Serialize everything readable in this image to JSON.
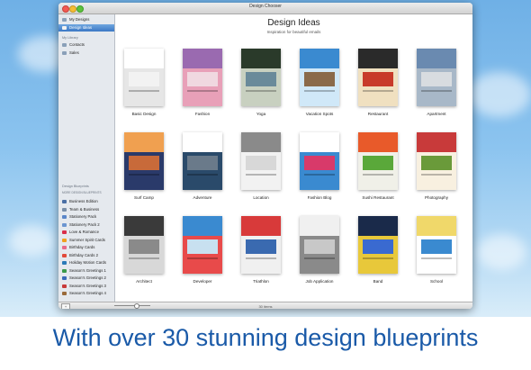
{
  "window": {
    "title": "Design Chooser"
  },
  "sidebar": {
    "top_items": [
      {
        "label": "My Designs",
        "color": "#8aa0b8"
      },
      {
        "label": "Design Ideas",
        "color": "#f2f2f2"
      }
    ],
    "library_heading": "My Library",
    "library_items": [
      {
        "label": "Contacts",
        "color": "#8aa0b8"
      },
      {
        "label": "Sales",
        "color": "#8aa0b8"
      }
    ],
    "blueprints_heading": "Design Blueprints",
    "more_heading": "MORE DESIGN BLUEPRINTS",
    "blueprints": [
      {
        "label": "Business Edition",
        "color": "#4a6fa5"
      },
      {
        "label": "Team & Business",
        "color": "#7a8fa8"
      },
      {
        "label": "Stationery Pack",
        "color": "#5a86c8"
      },
      {
        "label": "Stationery Pack 2",
        "color": "#6b95d0"
      },
      {
        "label": "Love & Romance",
        "color": "#d9304a"
      },
      {
        "label": "Summer Spirit Cards",
        "color": "#f0a020"
      },
      {
        "label": "Birthday Cards",
        "color": "#e86a8a"
      },
      {
        "label": "Birthday Cards 2",
        "color": "#e24a3a"
      },
      {
        "label": "Holiday Motion Cards",
        "color": "#2a7ab8"
      },
      {
        "label": "Season's Greetings 1",
        "color": "#3a9a4a"
      },
      {
        "label": "Season's Greetings 2",
        "color": "#3a6ab8"
      },
      {
        "label": "Season's Greetings 3",
        "color": "#c83a3a"
      },
      {
        "label": "Season's Greetings 4",
        "color": "#9a6a3a"
      }
    ]
  },
  "content": {
    "title": "Design Ideas",
    "subtitle": "Inspiration for beautiful emails",
    "designs": [
      {
        "label": "Basic Design",
        "colors": [
          "#ffffff",
          "#f2f2f2",
          "#e6e6e6"
        ]
      },
      {
        "label": "Fashion",
        "colors": [
          "#9a6ab0",
          "#f0d8e0",
          "#e8a0b8"
        ]
      },
      {
        "label": "Yoga",
        "colors": [
          "#2a3a2a",
          "#6a8a9a",
          "#c8d0c0"
        ]
      },
      {
        "label": "Vacation Spots",
        "colors": [
          "#3a8ad0",
          "#8a6a4a",
          "#d0e8f8"
        ]
      },
      {
        "label": "Restaurant",
        "colors": [
          "#2a2a2a",
          "#c83a2a",
          "#f0e0c0"
        ]
      },
      {
        "label": "Apartment",
        "colors": [
          "#6a8ab0",
          "#d8dce0",
          "#a8b8c8"
        ]
      },
      {
        "label": "Surf Camp",
        "colors": [
          "#f0a050",
          "#c86a3a",
          "#2a3a6a"
        ]
      },
      {
        "label": "Adventure",
        "colors": [
          "#ffffff",
          "#6a7a8a",
          "#2a4a6a"
        ]
      },
      {
        "label": "Location",
        "colors": [
          "#8a8a8a",
          "#d8d8d8",
          "#f2f2f2"
        ]
      },
      {
        "label": "Fashion Blog",
        "colors": [
          "#ffffff",
          "#d83a6a",
          "#3a8ad0"
        ]
      },
      {
        "label": "Sushi Restaurant",
        "colors": [
          "#e85a2a",
          "#5aa83a",
          "#f0f0e8"
        ]
      },
      {
        "label": "Photography",
        "colors": [
          "#c83a3a",
          "#6a9a3a",
          "#f8f0e0"
        ]
      },
      {
        "label": "Architect",
        "colors": [
          "#3a3a3a",
          "#8a8a8a",
          "#d8d8d8"
        ]
      },
      {
        "label": "Developer",
        "colors": [
          "#3a8ad0",
          "#c8e0f0",
          "#e84a4a"
        ]
      },
      {
        "label": "Triathlon",
        "colors": [
          "#d83a3a",
          "#3a6ab0",
          "#f0f0f0"
        ]
      },
      {
        "label": "Job Application",
        "colors": [
          "#f0f0f0",
          "#c8c8c8",
          "#8a8a8a"
        ]
      },
      {
        "label": "Band",
        "colors": [
          "#1a2a4a",
          "#3a6ad0",
          "#e8c83a"
        ]
      },
      {
        "label": "School",
        "colors": [
          "#f0d86a",
          "#3a8ad0",
          "#ffffff"
        ]
      }
    ]
  },
  "status": {
    "count": "30 items",
    "add_label": "+"
  },
  "caption": "With over 30 stunning design blueprints"
}
